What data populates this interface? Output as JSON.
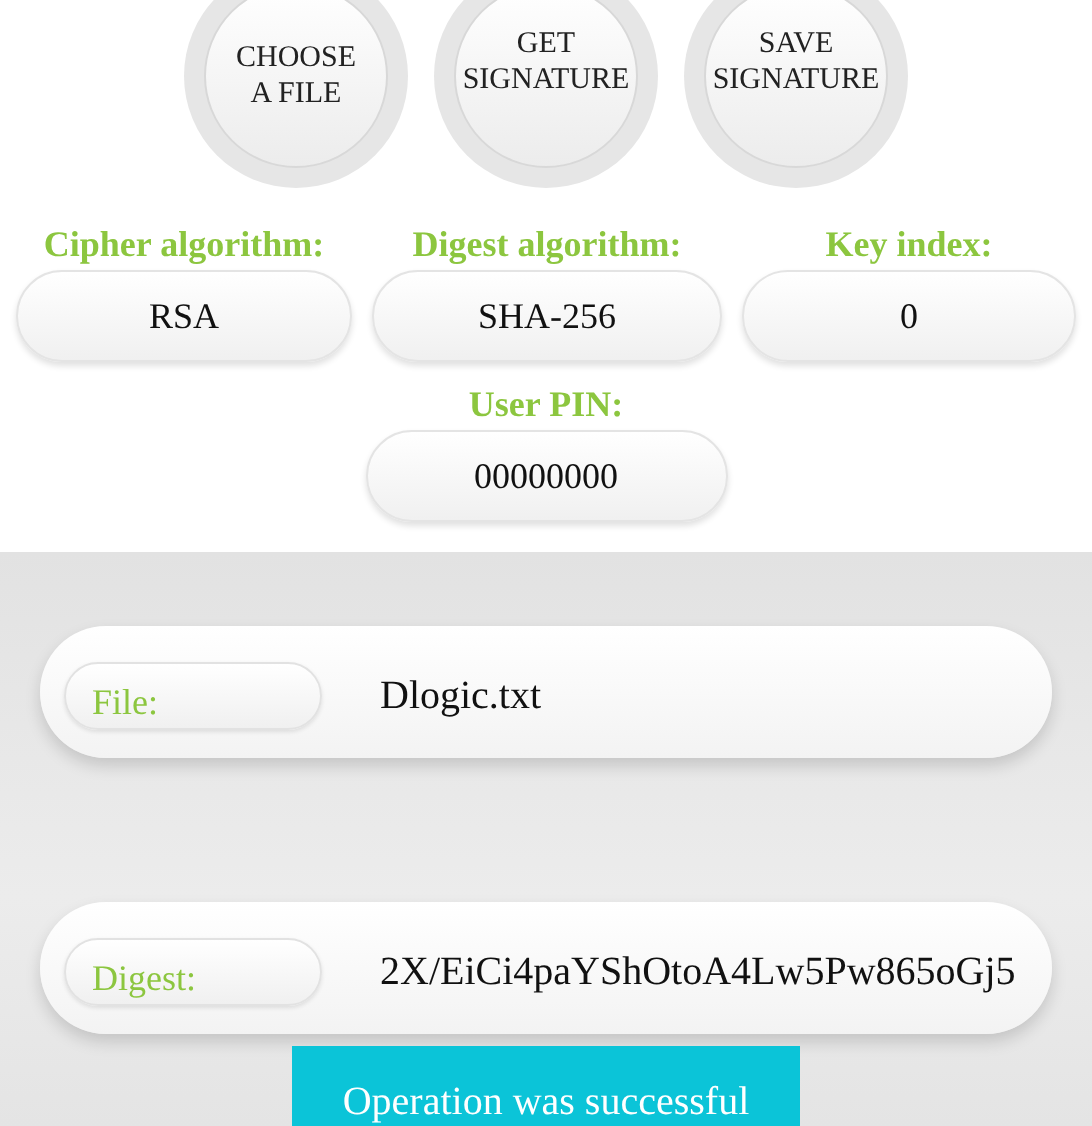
{
  "actions": [
    {
      "label": "CHOOSE\nA FILE"
    },
    {
      "label": "GET\nSIGNATURE"
    },
    {
      "label": "SAVE\nSIGNATURE"
    }
  ],
  "settings": [
    {
      "label": "Cipher algorithm:",
      "value": "RSA"
    },
    {
      "label": "Digest algorithm:",
      "value": "SHA-256"
    },
    {
      "label": "Key index:",
      "value": "0"
    }
  ],
  "pin": {
    "label": "User PIN:",
    "value": "00000000"
  },
  "results": [
    {
      "label": "File:",
      "value": "Dlogic.txt"
    },
    {
      "label": "Digest:",
      "value": "2X/EiCi4paYShOtoA4Lw5Pw865oGj5"
    }
  ],
  "toast": "Operation was successful"
}
